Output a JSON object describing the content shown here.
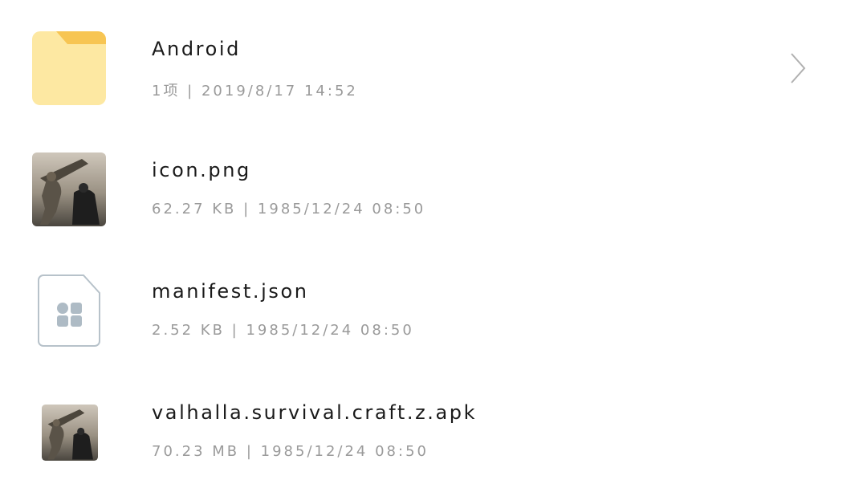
{
  "files": [
    {
      "name": "Android",
      "meta": "1项 | 2019/8/17 14:52",
      "type": "folder",
      "icon": "folder-icon",
      "has_chevron": true
    },
    {
      "name": "icon.png",
      "meta": "62.27 KB | 1985/12/24 08:50",
      "type": "image",
      "icon": "image-thumbnail"
    },
    {
      "name": "manifest.json",
      "meta": "2.52 KB | 1985/12/24 08:50",
      "type": "file",
      "icon": "document-icon"
    },
    {
      "name": "valhalla.survival.craft.z.apk",
      "meta": "70.23 MB | 1985/12/24 08:50",
      "type": "apk",
      "icon": "apk-thumbnail"
    }
  ],
  "colors": {
    "folder_body": "#fde8a2",
    "folder_tab": "#f7c553",
    "doc_border": "#b7c2ca",
    "doc_glyph": "#aebbc5",
    "name_text": "#1a1a1a",
    "meta_text": "#9a9a9a",
    "chevron": "#b0b0b0"
  }
}
